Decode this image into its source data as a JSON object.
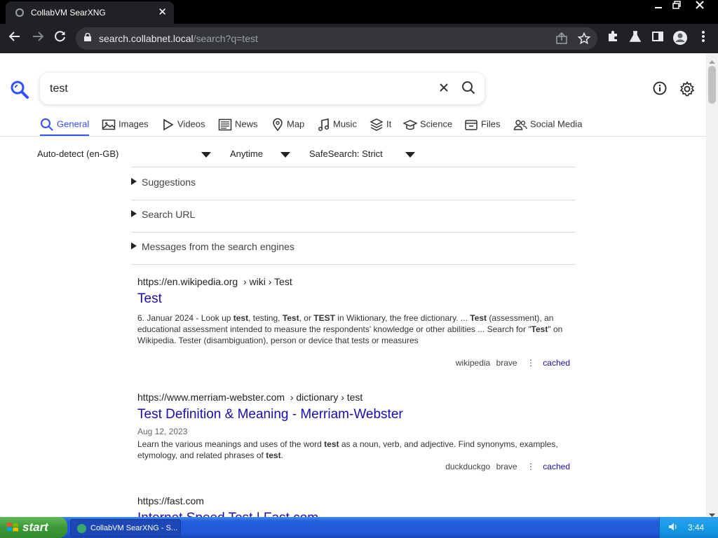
{
  "browser": {
    "tab_title": "CollabVM SearXNG",
    "url_host": "search.collabnet.local",
    "url_path": "/search?q=test"
  },
  "search": {
    "query": "test",
    "categories": [
      {
        "label": "General",
        "icon": "search-icon",
        "active": true
      },
      {
        "label": "Images",
        "icon": "image-icon",
        "active": false
      },
      {
        "label": "Videos",
        "icon": "play-icon",
        "active": false
      },
      {
        "label": "News",
        "icon": "newspaper-icon",
        "active": false
      },
      {
        "label": "Map",
        "icon": "map-pin-icon",
        "active": false
      },
      {
        "label": "Music",
        "icon": "music-note-icon",
        "active": false
      },
      {
        "label": "It",
        "icon": "layers-icon",
        "active": false
      },
      {
        "label": "Science",
        "icon": "graduation-cap-icon",
        "active": false
      },
      {
        "label": "Files",
        "icon": "archive-icon",
        "active": false
      },
      {
        "label": "Social Media",
        "icon": "people-icon",
        "active": false
      }
    ],
    "filters": {
      "language": "Auto-detect (en-GB)",
      "time": "Anytime",
      "safesearch": "SafeSearch: Strict"
    },
    "details": [
      "Suggestions",
      "Search URL",
      "Messages from the search engines"
    ]
  },
  "results": [
    {
      "url_main": "https://en.wikipedia.org",
      "url_path": "› wiki › Test",
      "title": "Test",
      "date": "",
      "snippet_parts": [
        {
          "t": "6. Januar 2024 - Look up ",
          "b": false
        },
        {
          "t": "test",
          "b": true
        },
        {
          "t": ", testing, ",
          "b": false
        },
        {
          "t": "Test",
          "b": true
        },
        {
          "t": ", or ",
          "b": false
        },
        {
          "t": "TEST",
          "b": true
        },
        {
          "t": " in Wiktionary, the free dictionary. ... ",
          "b": false
        },
        {
          "t": "Test",
          "b": true
        },
        {
          "t": " (assessment), an educational assessment intended to measure the respondents' knowledge or other abilities ... Search for \"",
          "b": false
        },
        {
          "t": "Test",
          "b": true
        },
        {
          "t": "\" on Wikipedia. Tester (disambiguation), person or device that tests or measures",
          "b": false
        }
      ],
      "engines": [
        "wikipedia",
        "brave"
      ],
      "cached": "cached"
    },
    {
      "url_main": "https://www.merriam-webster.com",
      "url_path": "› dictionary › test",
      "title": "Test Definition & Meaning - Merriam-Webster",
      "date": "Aug 12, 2023",
      "snippet_parts": [
        {
          "t": "Learn the various meanings and uses of the word ",
          "b": false
        },
        {
          "t": "test",
          "b": true
        },
        {
          "t": " as a noun, verb, and adjective. Find synonyms, examples, etymology, and related phrases of ",
          "b": false
        },
        {
          "t": "test",
          "b": true
        },
        {
          "t": ".",
          "b": false
        }
      ],
      "engines": [
        "duckduckgo",
        "brave"
      ],
      "cached": "cached"
    },
    {
      "url_main": "https://fast.com",
      "url_path": "",
      "title": "Internet Speed Test | Fast.com"
    }
  ],
  "taskbar": {
    "start_label": "start",
    "task_label": "CollabVM SearXNG - S...",
    "clock": "3:44"
  },
  "colors": {
    "accent": "#3050ff",
    "link": "#1a0dab",
    "chrome_dark": "#202124"
  }
}
